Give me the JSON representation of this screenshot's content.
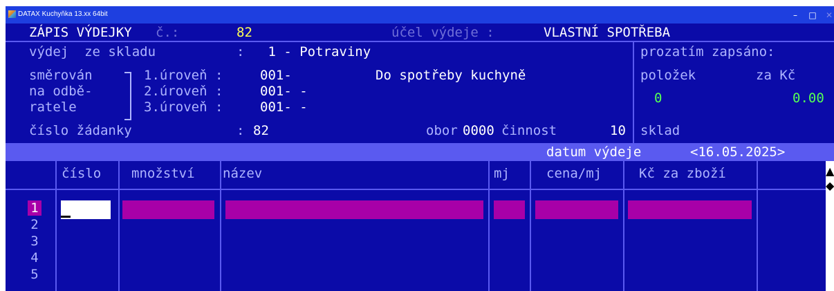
{
  "window": {
    "title": "DATAX Kuchyňka 13.xx 64bit",
    "minimize": "–",
    "maximize": "□",
    "close": "✕"
  },
  "header": {
    "title": "ZÁPIS VÝDEJKY",
    "number_label": "č.:",
    "number": "82",
    "purpose_label": "účel výdeje :",
    "purpose_value": "VLASTNÍ SPOTŘEBA"
  },
  "form": {
    "warehouse_label": "výdej  ze skladu",
    "warehouse_colon": ":",
    "warehouse_value": " 1 - Potraviny",
    "routed_label_1": "směrován",
    "routed_label_2": "na odbě-",
    "routed_label_3": "ratele",
    "level1_label": "1.úroveň :",
    "level1_code": "001-",
    "level1_name": "Do spotřeby kuchyně",
    "level2_label": "2.úroveň :",
    "level2_code": "001- -",
    "level3_label": "3.úroveň :",
    "level3_code": "001- -",
    "request_label": "číslo žádanky",
    "request_colon": ":",
    "request_value": "82",
    "obor_label": "obor",
    "obor_value": "0000",
    "cinnost_label": "činnost",
    "cinnost_value": "10",
    "sklad_label": "sklad"
  },
  "summary": {
    "title": "prozatím zapsáno:",
    "items_label": "položek",
    "amount_label": "za Kč",
    "items_value": "0",
    "amount_value": "0.00"
  },
  "date": {
    "label": "datum výdeje",
    "value": "<16.05.2025>"
  },
  "table": {
    "columns": [
      "číslo",
      "množství",
      "název",
      "mj",
      "cena/mj",
      "Kč za zboží"
    ],
    "row_numbers": [
      "1",
      "2",
      "3",
      "4",
      "5"
    ]
  },
  "scroll": {
    "up": "▲",
    "thumb": "◆"
  }
}
